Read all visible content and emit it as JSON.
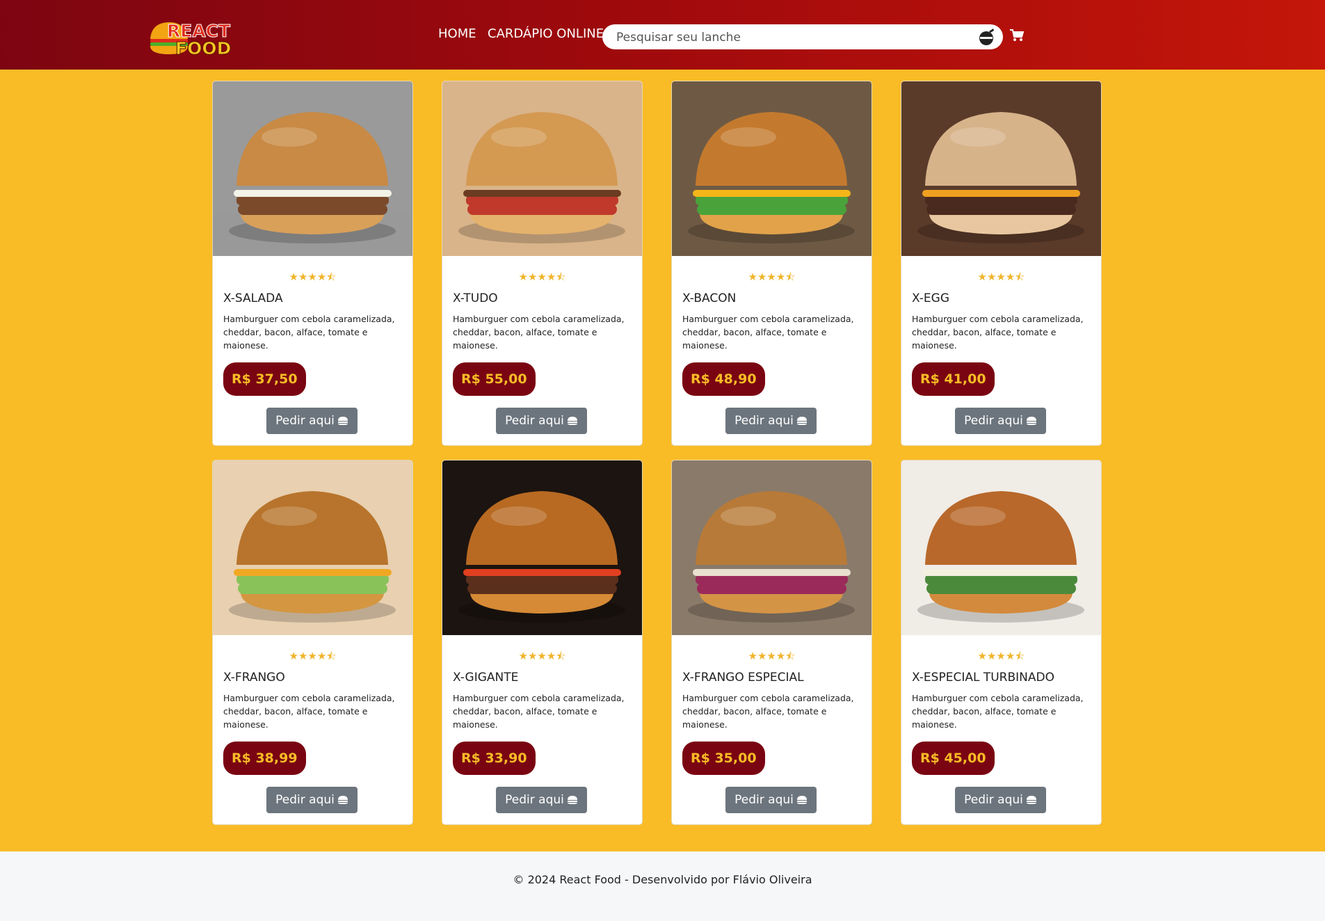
{
  "header": {
    "logo_line1": "REACT",
    "logo_line2": "FOOD",
    "nav_home": "HOME",
    "nav_menu": "CARDÁPIO ONLINE",
    "search_placeholder": "Pesquisar seu lanche"
  },
  "colors": {
    "header_gradient": [
      "#7d0511",
      "#c4160a"
    ],
    "background": "#f9bc26",
    "price_badge": "#7a0512",
    "price_text": "#f9bc26",
    "button": "#6c757d"
  },
  "products": [
    {
      "name": "X-SALADA",
      "rating": 4.5,
      "stars": "★★★★⯪",
      "description": "Hamburguer com cebola caramelizada, cheddar, bacon, alface, tomate e maionese.",
      "price": "R$ 37,50",
      "button": "Pedir aqui"
    },
    {
      "name": "X-TUDO",
      "rating": 4.5,
      "stars": "★★★★⯪",
      "description": "Hamburguer com cebola caramelizada, cheddar, bacon, alface, tomate e maionese.",
      "price": "R$ 55,00",
      "button": "Pedir aqui"
    },
    {
      "name": "X-BACON",
      "rating": 4.5,
      "stars": "★★★★⯪",
      "description": "Hamburguer com cebola caramelizada, cheddar, bacon, alface, tomate e maionese.",
      "price": "R$ 48,90",
      "button": "Pedir aqui"
    },
    {
      "name": "X-EGG",
      "rating": 4.5,
      "stars": "★★★★⯪",
      "description": "Hamburguer com cebola caramelizada, cheddar, bacon, alface, tomate e maionese.",
      "price": "R$ 41,00",
      "button": "Pedir aqui"
    },
    {
      "name": "X-FRANGO",
      "rating": 4.5,
      "stars": "★★★★⯪",
      "description": "Hamburguer com cebola caramelizada, cheddar, bacon, alface, tomate e maionese.",
      "price": "R$ 38,99",
      "button": "Pedir aqui"
    },
    {
      "name": "X-GIGANTE",
      "rating": 4.5,
      "stars": "★★★★⯪",
      "description": "Hamburguer com cebola caramelizada, cheddar, bacon, alface, tomate e maionese.",
      "price": "R$ 33,90",
      "button": "Pedir aqui"
    },
    {
      "name": "X-FRANGO ESPECIAL",
      "rating": 4.5,
      "stars": "★★★★⯪",
      "description": "Hamburguer com cebola caramelizada, cheddar, bacon, alface, tomate e maionese.",
      "price": "R$ 35,00",
      "button": "Pedir aqui"
    },
    {
      "name": "X-ESPECIAL TURBINADO",
      "rating": 4.5,
      "stars": "★★★★⯪",
      "description": "Hamburguer com cebola caramelizada, cheddar, bacon, alface, tomate e maionese.",
      "price": "R$ 45,00",
      "button": "Pedir aqui"
    }
  ],
  "footer": {
    "text": "© 2024 React Food - Desenvolvido por Flávio Oliveira"
  }
}
